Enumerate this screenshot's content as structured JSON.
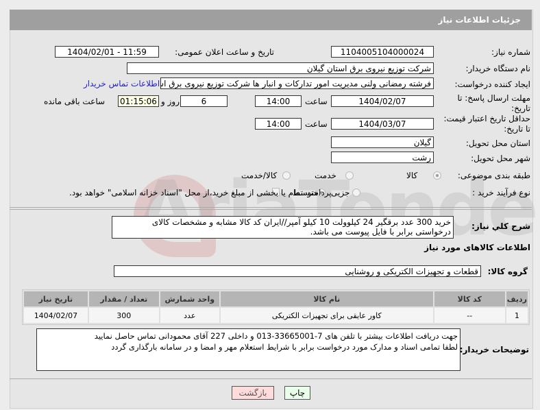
{
  "header": {
    "title": "جزئیات اطلاعات نیاز"
  },
  "form": {
    "need_number_label": "شماره نیاز:",
    "need_number": "1104005104000024",
    "announce_label": "تاریخ و ساعت اعلان عمومی:",
    "announce_value": "1404/02/01 - 11:59",
    "buyer_org_label": "نام دستگاه خریدار:",
    "buyer_org": "شرکت توزیع نیروی برق استان گیلان",
    "creator_label": "ایجاد کننده درخواست:",
    "creator": "فرشته رمضانی ولنی مدیریت امور تدارکات و انبار ها شرکت توزیع نیروی برق استا",
    "contact_link": "اطلاعات تماس خریدار",
    "deadline_label": "مهلت ارسال پاسخ: تا تاریخ:",
    "deadline_date": "1404/02/07",
    "time_label": "ساعت",
    "deadline_time": "14:00",
    "days": "6",
    "days_label": "روز و",
    "remaining": "01:15:06",
    "remaining_label": "ساعت باقی مانده",
    "validity_label": "حداقل تاریخ اعتبار قیمت: تا تاریخ:",
    "validity_date": "1404/03/07",
    "validity_time": "14:00",
    "province_label": "استان محل تحویل:",
    "province": "گیلان",
    "city_label": "شهر محل تحویل:",
    "city": "رشت",
    "category_label": "طبقه بندی موضوعی:",
    "category_options": [
      "کالا",
      "خدمت",
      "کالا/خدمت"
    ],
    "process_label": "نوع فرآیند خرید :",
    "process_options": [
      "جزیی",
      "متوسط"
    ],
    "payment_note": "پرداخت تمام یا بخشی از مبلغ خرید،از محل \"اسناد خزانه اسلامی\" خواهد بود.",
    "description_label": "شرح کلي نياز:",
    "description": "خرید 300 عدد برقگیر 24 کیلوولت 10 کیلو آمپر//ایران کد کالا مشابه و مشخصات کالای درخواستی برابر با فایل پیوست می باشد.",
    "goods_section": "اطلاعات کالاهای مورد نیاز",
    "group_label": "گروه کالا:",
    "group": "قطعات و تجهیزات الکتریکی و روشنایی"
  },
  "table": {
    "headers": [
      "ردیف",
      "کد کالا",
      "نام کالا",
      "واحد شمارش",
      "تعداد / مقدار",
      "تاریخ نیاز"
    ],
    "rows": [
      [
        "1",
        "--",
        "کاور عایقی برای تجهیزات الکتریکی",
        "عدد",
        "300",
        "1404/02/07"
      ]
    ]
  },
  "notes": {
    "label": "توضیحات خریدار:",
    "line1": "جهت دریافت اطلاعات بیشتر با تلفن های 7-33665001-013 و داخلی 227 آقای محمودانی تماس حاصل نمایید",
    "line2": "لطفا تمامی اسناد و مدارک مورد درخواست برابر با شرایط استعلام مهر و امضا و در سامانه بارگذاری گردد"
  },
  "buttons": {
    "print": "چاپ",
    "back": "بازگشت"
  },
  "watermark": "AriaTender.neT"
}
